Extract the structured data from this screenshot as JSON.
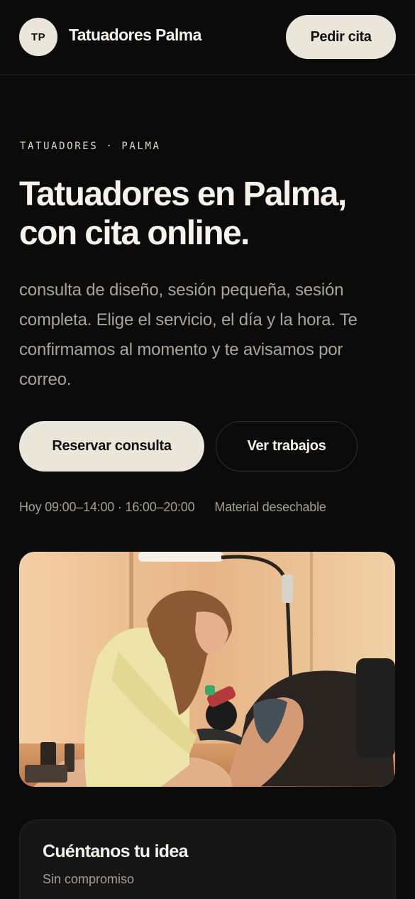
{
  "header": {
    "logo_initials": "TP",
    "brand_name": "Tatuadores Palma",
    "cta_label": "Pedir cita"
  },
  "hero": {
    "eyebrow": "TATUADORES · PALMA",
    "headline": "Tatuadores en Palma, con cita online.",
    "lead": "consulta de diseño, sesión pequeña, sesión completa. Elige el servicio, el día y la hora. Te confirmamos al momento y te avisamos por correo.",
    "primary_button": "Reservar consulta",
    "secondary_button": "Ver trabajos",
    "hours": "Hoy 09:00–14:00 · 16:00–20:00",
    "feature": "Material desechable"
  },
  "card": {
    "title": "Cuéntanos tu idea",
    "subtitle": "Sin compromiso"
  },
  "colors": {
    "background": "#0b0b0b",
    "accent": "#ebe6da",
    "muted_text": "#a39e94"
  }
}
